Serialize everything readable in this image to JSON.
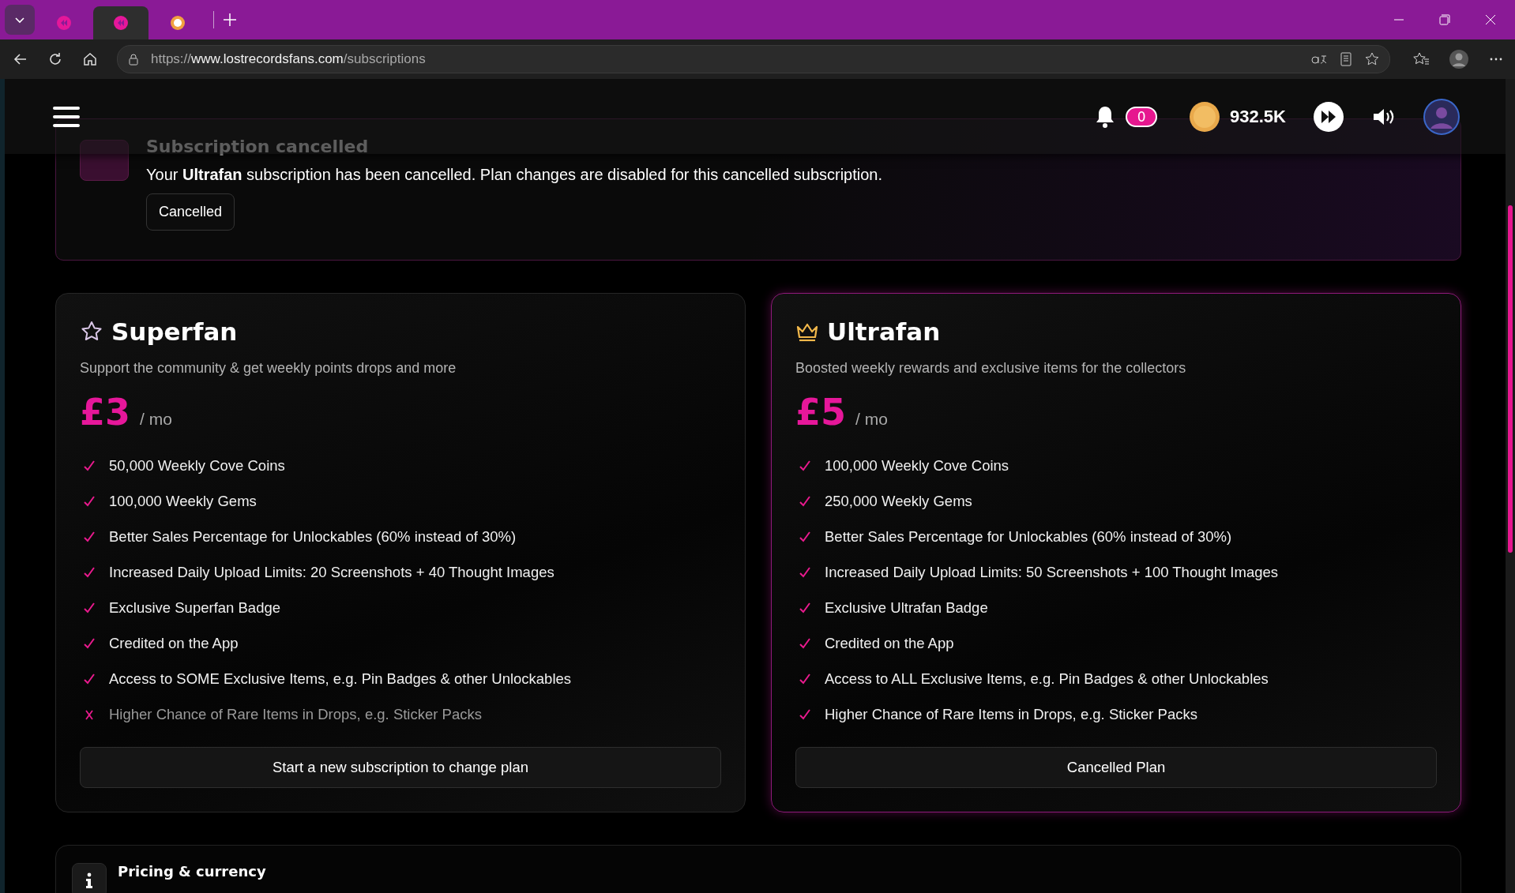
{
  "browser": {
    "tabs": [
      {
        "kind": "rewind",
        "selected": false
      },
      {
        "kind": "rewind",
        "selected": true
      },
      {
        "kind": "letter",
        "selected": false
      }
    ],
    "url_scheme": "https://",
    "url_host": "www.lostrecordsfans.com",
    "url_path": "/subscriptions"
  },
  "header": {
    "notification_count": "0",
    "coins": "932.5K"
  },
  "notice": {
    "title": "Subscription cancelled",
    "message": "Your **Ultrafan** subscription has been cancelled. Plan changes are disabled for this cancelled subscription.",
    "status": "Cancelled"
  },
  "plans": [
    {
      "name": "Superfan",
      "kind": "star",
      "highlighted": false,
      "description": "Support the community & get weekly points drops and more",
      "price": "£3",
      "period": "/ mo",
      "button": "Start a new subscription to change plan",
      "features": [
        {
          "text": "50,000 Weekly Cove Coins",
          "included": true
        },
        {
          "text": "100,000 Weekly Gems",
          "included": true
        },
        {
          "text": "Better Sales Percentage for Unlockables (60% instead of 30%)",
          "included": true
        },
        {
          "text": "Increased Daily Upload Limits: 20 Screenshots + 40 Thought Images",
          "included": true
        },
        {
          "text": "Exclusive Superfan Badge",
          "included": true
        },
        {
          "text": "Credited on the App",
          "included": true
        },
        {
          "text": "Access to SOME Exclusive Items, e.g. Pin Badges & other Unlockables",
          "included": true
        },
        {
          "text": "Higher Chance of Rare Items in Drops, e.g. Sticker Packs",
          "included": false
        }
      ]
    },
    {
      "name": "Ultrafan",
      "kind": "crown",
      "highlighted": true,
      "description": "Boosted weekly rewards and exclusive items for the collectors",
      "price": "£5",
      "period": "/ mo",
      "button": "Cancelled Plan",
      "features": [
        {
          "text": "100,000 Weekly Cove Coins",
          "included": true
        },
        {
          "text": "250,000 Weekly Gems",
          "included": true
        },
        {
          "text": "Better Sales Percentage for Unlockables (60% instead of 30%)",
          "included": true
        },
        {
          "text": "Increased Daily Upload Limits: 50 Screenshots + 100 Thought Images",
          "included": true
        },
        {
          "text": "Exclusive Ultrafan Badge",
          "included": true
        },
        {
          "text": "Credited on the App",
          "included": true
        },
        {
          "text": "Access to ALL Exclusive Items, e.g. Pin Badges & other Unlockables",
          "included": true
        },
        {
          "text": "Higher Chance of Rare Items in Drops, e.g. Sticker Packs",
          "included": true
        }
      ]
    }
  ],
  "pricing_note": {
    "title": "Pricing & currency"
  }
}
